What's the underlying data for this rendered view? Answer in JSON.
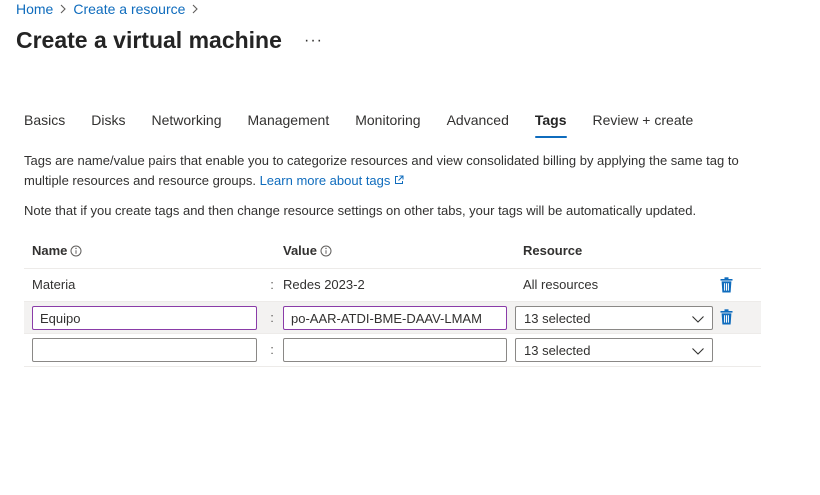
{
  "breadcrumb": {
    "items": [
      "Home",
      "Create a resource"
    ]
  },
  "page": {
    "title": "Create a virtual machine",
    "more_label": "···"
  },
  "tabs": [
    {
      "label": "Basics",
      "active": false
    },
    {
      "label": "Disks",
      "active": false
    },
    {
      "label": "Networking",
      "active": false
    },
    {
      "label": "Management",
      "active": false
    },
    {
      "label": "Monitoring",
      "active": false
    },
    {
      "label": "Advanced",
      "active": false
    },
    {
      "label": "Tags",
      "active": true
    },
    {
      "label": "Review + create",
      "active": false
    }
  ],
  "description": {
    "text": "Tags are name/value pairs that enable you to categorize resources and view consolidated billing by applying the same tag to multiple resources and resource groups.",
    "link_label": "Learn more about tags"
  },
  "note": "Note that if you create tags and then change resource settings on other tabs, your tags will be automatically updated.",
  "grid": {
    "headers": {
      "name": "Name",
      "value": "Value",
      "resource": "Resource"
    },
    "separator": ":",
    "rows": [
      {
        "name": "Materia",
        "value": "Redes 2023-2",
        "resource": "All resources"
      },
      {
        "name": "Equipo",
        "value": "po-AAR-ATDI-BME-DAAV-LMAM",
        "resource": "13 selected"
      },
      {
        "name": "",
        "value": "",
        "resource": "13 selected"
      }
    ]
  },
  "colors": {
    "accent": "#0f6cbd",
    "focus_border": "#8a3ca8",
    "row_highlight": "#f3f2f1"
  },
  "icons": {
    "breadcrumb_separator": "chevron-right-icon",
    "info": "info-icon",
    "external_link": "external-link-icon",
    "delete": "delete-icon",
    "dropdown": "chevron-down-icon"
  }
}
